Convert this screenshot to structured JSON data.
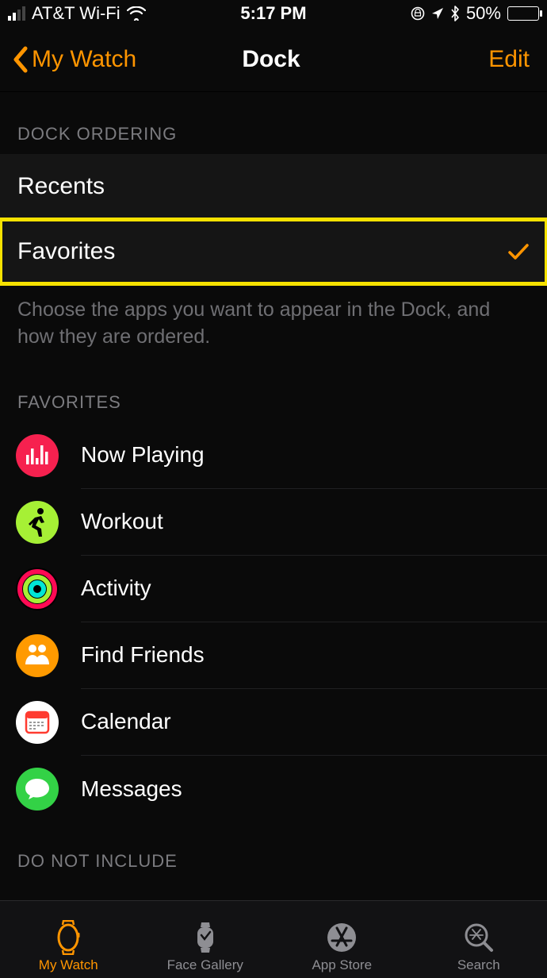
{
  "statusbar": {
    "carrier": "AT&T Wi-Fi",
    "time": "5:17 PM",
    "battery_pct": "50%"
  },
  "nav": {
    "back_label": "My Watch",
    "title": "Dock",
    "edit_label": "Edit"
  },
  "sections": {
    "ordering_header": "DOCK ORDERING",
    "recents_label": "Recents",
    "favorites_label": "Favorites",
    "ordering_footer": "Choose the apps you want to appear in the Dock, and how they are ordered.",
    "favorites_header": "FAVORITES",
    "do_not_include_header": "DO NOT INCLUDE"
  },
  "favorites": [
    {
      "name": "Now Playing",
      "icon": "now-playing",
      "bg": "#f6214f"
    },
    {
      "name": "Workout",
      "icon": "workout",
      "bg": "#a6f035"
    },
    {
      "name": "Activity",
      "icon": "activity",
      "bg": "#000000"
    },
    {
      "name": "Find Friends",
      "icon": "find-friends",
      "bg": "#ff9a00"
    },
    {
      "name": "Calendar",
      "icon": "calendar",
      "bg": "#ffffff"
    },
    {
      "name": "Messages",
      "icon": "messages",
      "bg": "#33d246"
    }
  ],
  "tabs": [
    {
      "label": "My Watch",
      "icon": "watch",
      "active": true
    },
    {
      "label": "Face Gallery",
      "icon": "face-gallery",
      "active": false
    },
    {
      "label": "App Store",
      "icon": "app-store",
      "active": false
    },
    {
      "label": "Search",
      "icon": "search",
      "active": false
    }
  ],
  "colors": {
    "accent": "#ff9500",
    "highlight": "#f6e100"
  }
}
